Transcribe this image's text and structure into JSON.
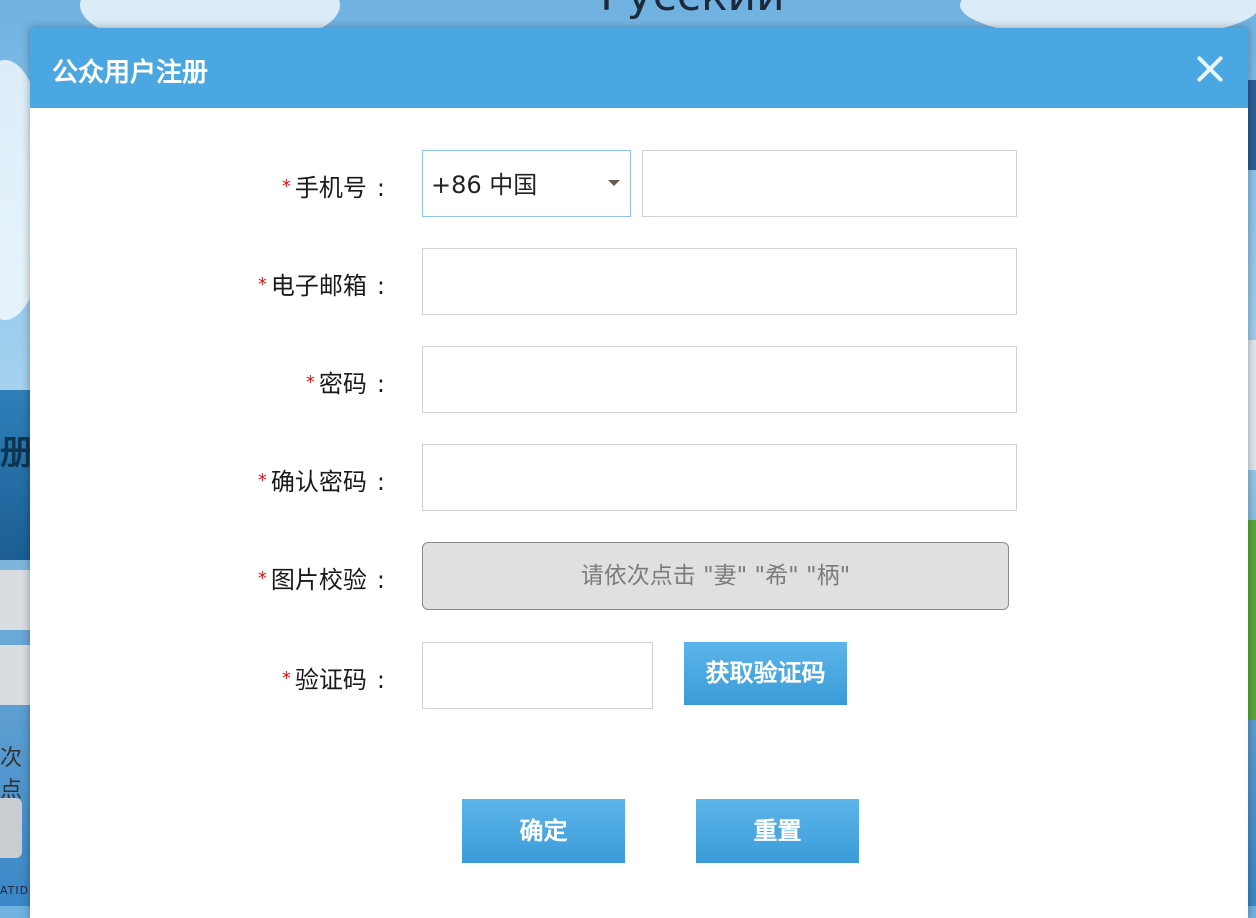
{
  "background": {
    "title_fragment": "Русский",
    "left_fragment": "册",
    "left_small_fragment": "次点",
    "footer_fragment": "ATID"
  },
  "dialog": {
    "title": "公众用户注册",
    "close_icon": "close-icon",
    "required_mark": "*",
    "colon": ":",
    "fields": {
      "phone_label": "手机号",
      "country_code_value": "+86 中国",
      "phone_value": "",
      "email_label": "电子邮箱",
      "email_value": "",
      "password_label": "密码",
      "password_value": "",
      "confirm_password_label": "确认密码",
      "confirm_password_value": "",
      "captcha_label": "图片校验",
      "captcha_prompt": "请依次点击 \"妻\" \"希\" \"柄\"",
      "sms_code_label": "验证码",
      "sms_code_value": ""
    },
    "buttons": {
      "get_code": "获取验证码",
      "confirm": "确定",
      "reset": "重置"
    }
  },
  "colors": {
    "header": "#4aa7e2",
    "button": "#3b9bd8",
    "required": "#d01a1a"
  }
}
